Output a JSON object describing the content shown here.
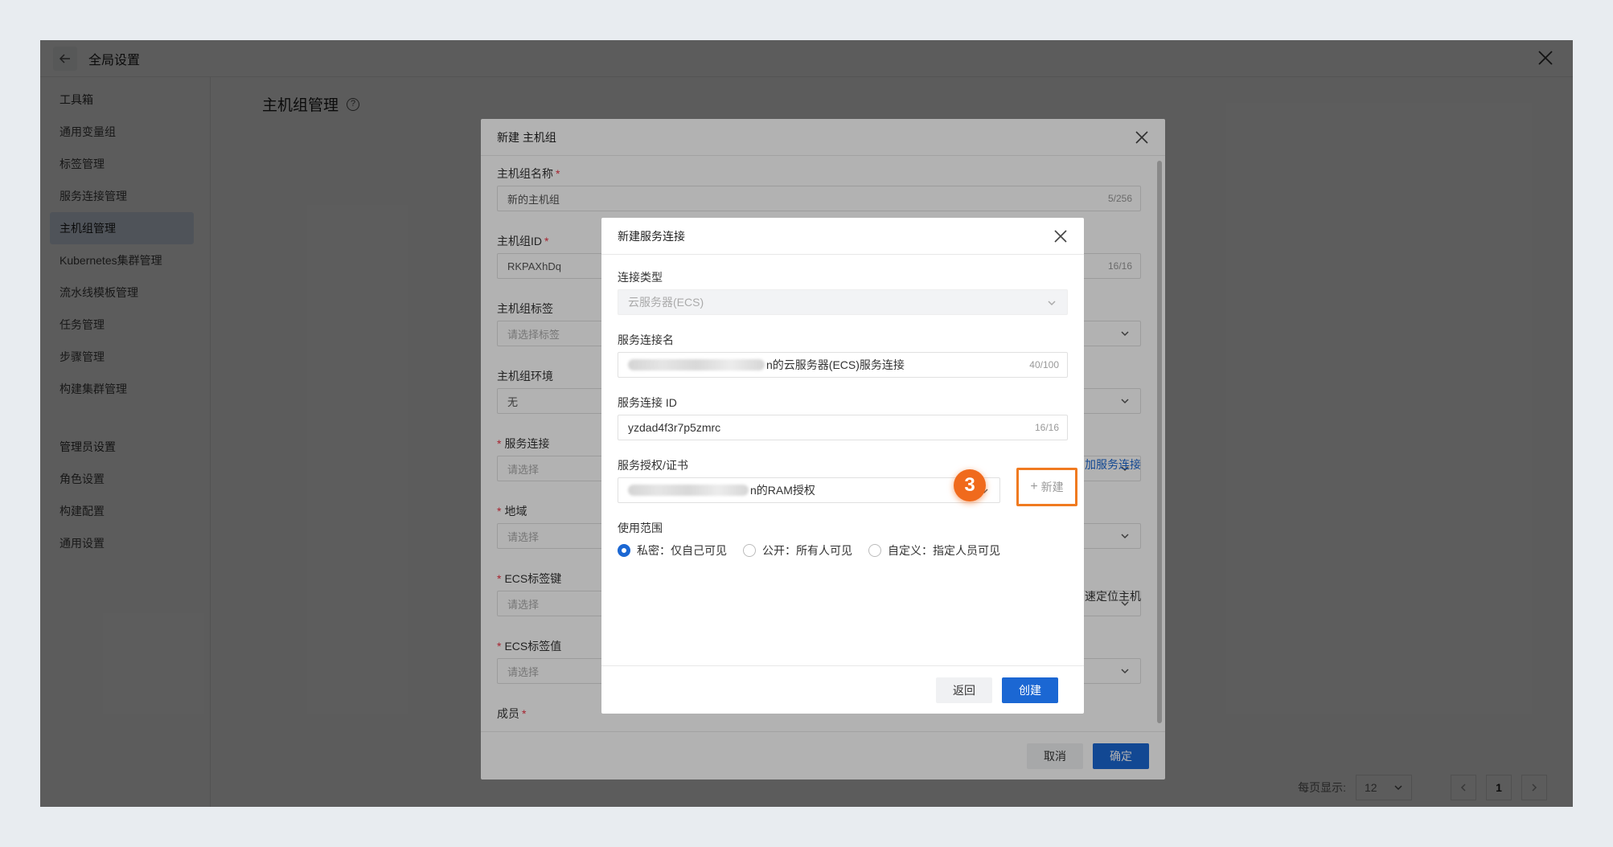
{
  "window": {
    "title": "全局设置"
  },
  "sidebar": {
    "group1": "工具箱",
    "items1": [
      {
        "label": "通用变量组"
      },
      {
        "label": "标签管理"
      },
      {
        "label": "服务连接管理"
      },
      {
        "label": "主机组管理"
      },
      {
        "label": "Kubernetes集群管理"
      },
      {
        "label": "流水线模板管理"
      },
      {
        "label": "任务管理"
      },
      {
        "label": "步骤管理"
      },
      {
        "label": "构建集群管理"
      }
    ],
    "group2": "管理员设置",
    "items2": [
      {
        "label": "角色设置"
      },
      {
        "label": "构建配置"
      },
      {
        "label": "通用设置"
      }
    ]
  },
  "main": {
    "title": "主机组管理",
    "help_glyph": "?"
  },
  "pagination": {
    "per_page_label": "每页显示:",
    "per_page_value": "12",
    "current_page": "1"
  },
  "dialog_host_group": {
    "title": "新建 主机组",
    "fields": {
      "name_label": "主机组名称",
      "name_value": "新的主机组",
      "name_count": "5/256",
      "id_label": "主机组ID",
      "id_value": "RKPAXhDq",
      "id_count": "16/16",
      "tag_label": "主机组标签",
      "tag_placeholder": "请选择标签",
      "env_label": "主机组环境",
      "env_value": "无",
      "conn_label": "服务连接",
      "conn_placeholder": "请选择",
      "add_conn_link": "加服务连接",
      "region_label": "地域",
      "region_placeholder": "请选择",
      "ecs_key_label": "ECS标签键",
      "ecs_key_placeholder": "请选择",
      "ecs_key_hint": "速定位主机",
      "ecs_val_label": "ECS标签值",
      "ecs_val_placeholder": "请选择",
      "member_label": "成员"
    },
    "cancel_label": "取消",
    "ok_label": "确定"
  },
  "dialog_service_conn": {
    "title": "新建服务连接",
    "type_label": "连接类型",
    "type_value": "云服务器(ECS)",
    "name_label": "服务连接名",
    "name_value_suffix": "的云服务器(ECS)服务连接",
    "name_prefix_visible": "n",
    "name_count": "40/100",
    "id_label": "服务连接 ID",
    "id_value": "yzdad4f3r7p5zmrc",
    "id_count": "16/16",
    "auth_label": "服务授权/证书",
    "auth_prefix_visible": "n",
    "auth_value_suffix": "的RAM授权",
    "new_button_label": "新建",
    "new_button_plus": "+",
    "step_badge": "3",
    "scope_label": "使用范围",
    "scope_options": [
      {
        "label": "私密：仅自己可见",
        "selected": true
      },
      {
        "label": "公开：所有人可见",
        "selected": false
      },
      {
        "label": "自定义：指定人员可见",
        "selected": false
      }
    ],
    "back_label": "返回",
    "create_label": "创建"
  },
  "colors": {
    "primary": "#1b67d3",
    "highlight": "#f07a20",
    "badge": "#f06a1c"
  }
}
